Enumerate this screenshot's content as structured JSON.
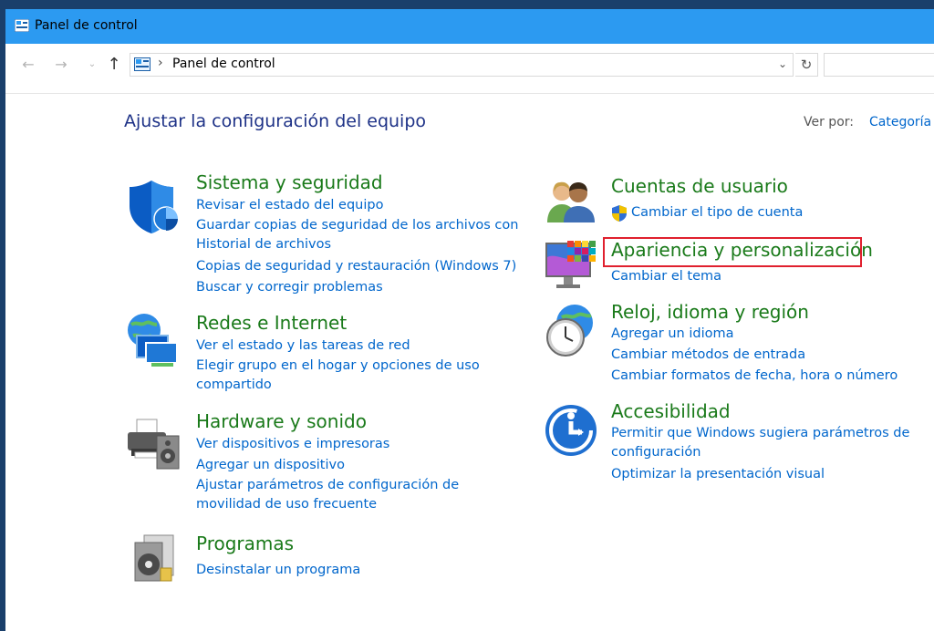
{
  "window": {
    "title": "Panel de control"
  },
  "address": {
    "crumb": "Panel de control",
    "dropdown_icon": "chevron-down-icon",
    "refresh_icon": "refresh-icon"
  },
  "nav": {
    "back_icon": "back-arrow-icon",
    "forward_icon": "forward-arrow-icon",
    "up_icon": "up-arrow-icon"
  },
  "main": {
    "heading": "Ajustar la configuración del equipo",
    "view_by_label": "Ver por:",
    "view_by_value": "Categoría"
  },
  "categories": {
    "system": {
      "title": "Sistema y seguridad",
      "links": [
        "Revisar el estado del equipo",
        "Guardar copias de seguridad de los archivos con Historial de archivos",
        "Copias de seguridad y restauración (Windows 7)",
        "Buscar y corregir problemas"
      ]
    },
    "network": {
      "title": "Redes e Internet",
      "links": [
        "Ver el estado y las tareas de red",
        "Elegir grupo en el hogar y opciones de uso compartido"
      ]
    },
    "hardware": {
      "title": "Hardware y sonido",
      "links": [
        "Ver dispositivos e impresoras",
        "Agregar un dispositivo",
        "Ajustar parámetros de configuración de movilidad de uso frecuente"
      ]
    },
    "programs": {
      "title": "Programas",
      "links": [
        "Desinstalar un programa"
      ]
    },
    "users": {
      "title": "Cuentas de usuario",
      "links": [
        "Cambiar el tipo de cuenta"
      ]
    },
    "appearance": {
      "title": "Apariencia y personalización",
      "links": [
        "Cambiar el tema"
      ]
    },
    "clock": {
      "title": "Reloj, idioma y región",
      "links": [
        "Agregar un idioma",
        "Cambiar métodos de entrada",
        "Cambiar formatos de fecha, hora o número"
      ]
    },
    "access": {
      "title": "Accesibilidad",
      "links": [
        "Permitir que Windows sugiera parámetros de configuración",
        "Optimizar la presentación visual"
      ]
    }
  },
  "colors": {
    "title_bar": "#2c9af1",
    "category_title": "#1a7a1a",
    "link": "#0066cc",
    "heading": "#1e3287",
    "highlight": "#e0202e"
  }
}
